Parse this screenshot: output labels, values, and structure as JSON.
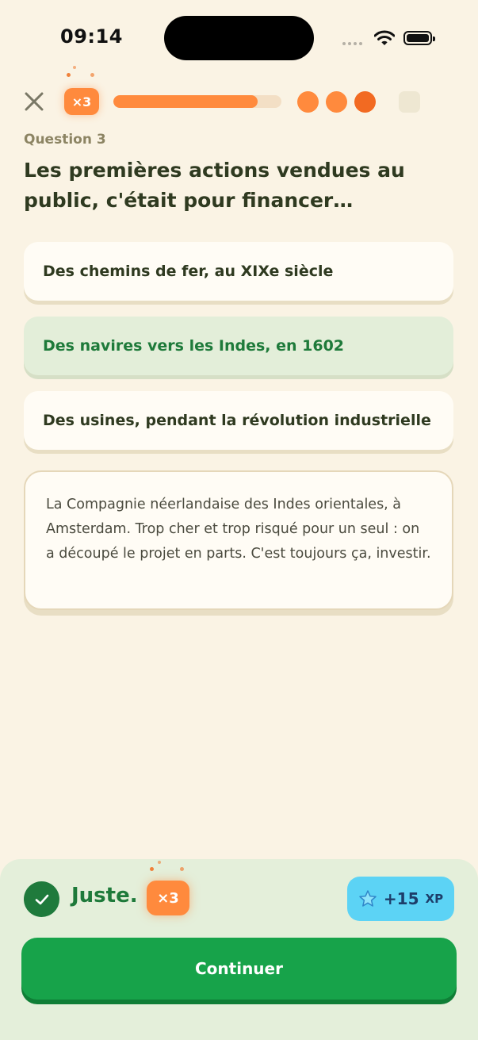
{
  "status_bar": {
    "time": "09:14"
  },
  "header": {
    "combo": "×3",
    "progress_fraction": 0.86,
    "dots_filled": 3,
    "dots_total": 4
  },
  "question": {
    "label": "Question 3",
    "text": "Les premières actions vendues au public, c'était pour financer…"
  },
  "answers": [
    {
      "label": "Des chemins de fer, au XIXe siècle",
      "state": "default"
    },
    {
      "label": "Des navires vers les Indes, en 1602",
      "state": "correct"
    },
    {
      "label": "Des usines, pendant la révolution industrielle",
      "state": "default"
    }
  ],
  "explanation": {
    "text": "La Compagnie néerlandaise des Indes orientales, à Amsterdam. Trop cher et trop risqué pour un seul : on a découpé le projet en parts. C'est toujours ça, investir."
  },
  "feedback": {
    "result": "Juste.",
    "combo": "×3",
    "xp_amount": "+15",
    "xp_unit": "XP",
    "continue_label": "Continuer"
  },
  "colors": {
    "background": "#FAF3E4",
    "accent_orange": "#FF8A3D",
    "success_green": "#17A34A",
    "correct_text": "#1E7A3A",
    "xp_blue": "#5CD3F5"
  }
}
